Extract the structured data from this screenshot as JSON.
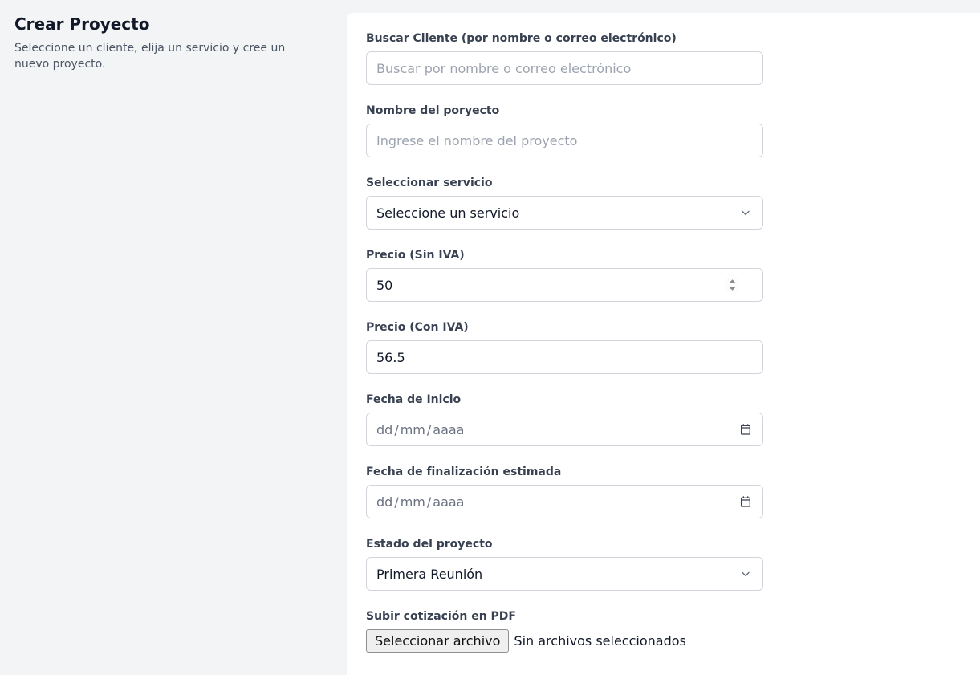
{
  "sidebar": {
    "title": "Crear Proyecto",
    "description": "Seleccione un cliente, elija un servicio y cree un nuevo proyecto."
  },
  "form": {
    "search_client": {
      "label": "Buscar Cliente (por nombre o correo electrónico)",
      "placeholder": "Buscar por nombre o correo electrónico",
      "value": ""
    },
    "project_name": {
      "label": "Nombre del poryecto",
      "placeholder": "Ingrese el nombre del proyecto",
      "value": ""
    },
    "service": {
      "label": "Seleccionar servicio",
      "selected": "Seleccione un servicio"
    },
    "price_no_vat": {
      "label": "Precio (Sin IVA)",
      "value": "50"
    },
    "price_vat": {
      "label": "Precio (Con IVA)",
      "value": "56.5"
    },
    "start_date": {
      "label": "Fecha de Inicio",
      "placeholder_day": "dd",
      "placeholder_month": "mm",
      "placeholder_year": "aaaa"
    },
    "end_date": {
      "label": "Fecha de finalización estimada",
      "placeholder_day": "dd",
      "placeholder_month": "mm",
      "placeholder_year": "aaaa"
    },
    "status": {
      "label": "Estado del proyecto",
      "selected": "Primera Reunión"
    },
    "upload": {
      "label": "Subir cotización en PDF",
      "button": "Seleccionar archivo",
      "status": "Sin archivos seleccionados"
    }
  }
}
